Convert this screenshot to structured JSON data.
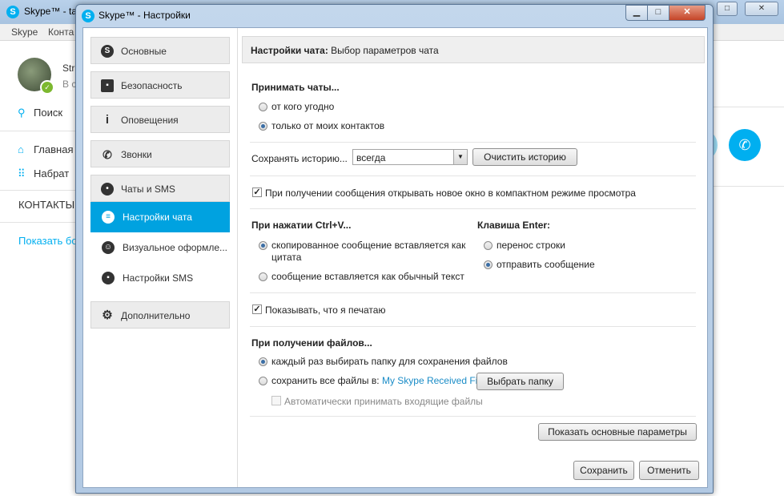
{
  "bg": {
    "title": "Skype™ - ta",
    "menu": [
      "Skype",
      "Конта"
    ],
    "profile_name": "Str",
    "profile_sub": "В с",
    "search": "Поиск",
    "home": "Главная",
    "dial": "Набрат",
    "contacts": "КОНТАКТЫ",
    "show": "Показать бо"
  },
  "dialog": {
    "title": "Skype™ - Настройки",
    "nav": {
      "general": "Основные",
      "security": "Безопасность",
      "notifications": "Оповещения",
      "calls": "Звонки",
      "chats_sms": "Чаты и SMS",
      "chat_settings": "Настройки чата",
      "appearance": "Визуальное оформле...",
      "sms_settings": "Настройки SMS",
      "advanced": "Дополнительно"
    },
    "header_bold": "Настройки чата:",
    "header_rest": " Выбор параметров чата",
    "accept_chats": {
      "label": "Принимать чаты...",
      "opt_anyone": "от кого угодно",
      "opt_contacts": "только от моих контактов"
    },
    "history": {
      "label": "Сохранять историю...",
      "value": "всегда",
      "clear_button": "Очистить историю"
    },
    "compact_view": "При получении сообщения открывать новое окно в компактном режиме просмотра",
    "paste": {
      "label": "При нажатии Ctrl+V...",
      "opt_quote_1": "скопированное сообщение вставляется как",
      "opt_quote_2": "цитата",
      "opt_plain": "сообщение вставляется как обычный текст"
    },
    "enter_key": {
      "label": "Клавиша Enter:",
      "opt_newline": "перенос строки",
      "opt_send": "отправить сообщение"
    },
    "show_typing": "Показывать, что я печатаю",
    "files": {
      "label": "При получении файлов...",
      "opt_ask": "каждый раз выбирать папку для сохранения файлов",
      "opt_save_prefix": "сохранить все файлы в:",
      "opt_save_folder": "My Skype Received Files",
      "choose_button": "Выбрать папку",
      "auto_accept": "Автоматически принимать входящие файлы"
    },
    "show_basic": "Показать основные параметры",
    "save": "Сохранить",
    "cancel": "Отменить"
  }
}
